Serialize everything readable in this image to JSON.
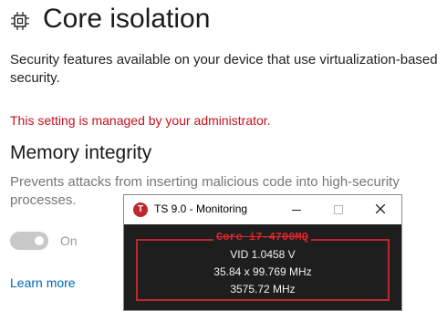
{
  "page": {
    "title": "Core isolation",
    "description": "Security features available on your device that use virtualization-based security.",
    "admin_note": "This setting is managed by your administrator."
  },
  "memory_integrity": {
    "heading": "Memory integrity",
    "description": "Prevents attacks from inserting malicious code into high-security processes.",
    "toggle_state": "On",
    "toggle_on": true,
    "toggle_disabled": true
  },
  "links": {
    "learn_more": "Learn more"
  },
  "monitor": {
    "app_icon_letter": "T",
    "title": "TS 9.0 - Monitoring",
    "cpu_name": "Core i7-4700MQ",
    "vid": "VID  1.0458 V",
    "multiplier": "35.84 x 99.769 MHz",
    "frequency": "3575.72 MHz"
  },
  "colors": {
    "admin_note": "#c50f1f",
    "link": "#0067b8",
    "monitor_accent": "#c0272d",
    "monitor_bg": "#1e1e1e"
  },
  "icons": {
    "page": "core-isolation-chip-icon",
    "app": "throttlestop-app-icon",
    "minimize": "minimize-icon",
    "maximize": "maximize-icon",
    "close": "close-icon"
  }
}
